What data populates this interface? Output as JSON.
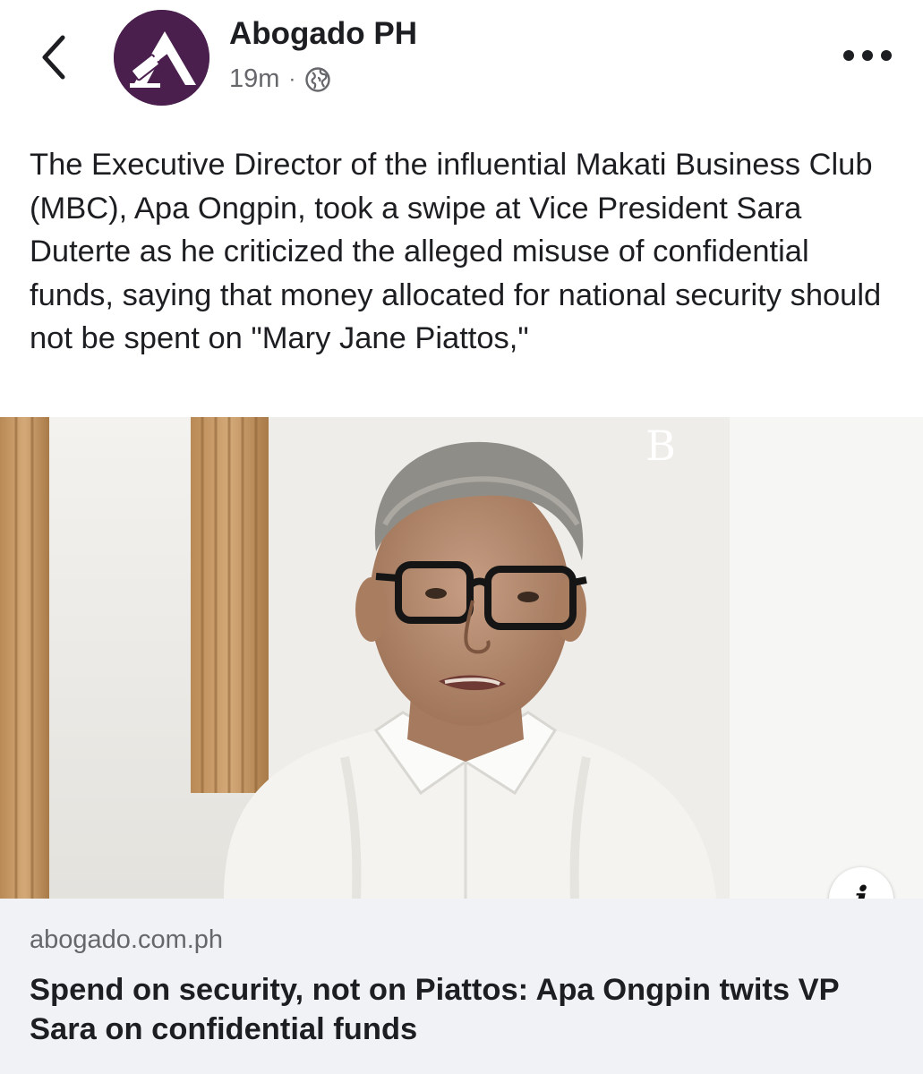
{
  "header": {
    "page_name": "Abogado PH",
    "time_ago": "19m",
    "separator": "·",
    "privacy_icon": "globe-icon",
    "back_icon": "chevron-left-icon",
    "more_icon": "more-horizontal-icon",
    "avatar_color": "#4a1f4e"
  },
  "post": {
    "text": "The Executive Director of the influential Makati Business Club (MBC), Apa Ongpin, took a swipe at Vice President Sara Duterte as he criticized the alleged misuse of confidential funds, saying that money allocated for national security should not be spent on \"Mary Jane Piattos,\""
  },
  "link": {
    "domain": "abogado.com.ph",
    "title": "Spend on security, not on Piattos: Apa Ongpin twits VP Sara on confidential funds",
    "info_glyph": "i",
    "image_watermark": "B",
    "footer_color": "#f0f2f5"
  }
}
